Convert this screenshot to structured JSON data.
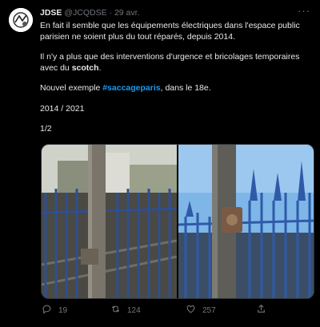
{
  "tweet": {
    "name": "JDSE",
    "handle": "@JCQDSE",
    "separator": "·",
    "date": "29 avr.",
    "more": "···",
    "p1": "En fait il semble que les équipements électriques dans l'espace public parisien ne soient plus du tout réparés, depuis 2014.",
    "p2_start": "Il n'y a plus que des interventions d'urgence et bricolages temporaires avec du ",
    "p2_bold": "scotch",
    "p2_end": ".",
    "p3_start": "Nouvel exemple ",
    "p3_hashtag": "#saccageparis",
    "p3_end": ", dans le 18e.",
    "p4": "2014 / 2021",
    "p5": "1/2"
  },
  "actions": {
    "reply_count": "19",
    "retweet_count": "124",
    "like_count": "257"
  },
  "icons": [
    "avatar",
    "more-icon",
    "reply-icon",
    "retweet-icon",
    "like-icon",
    "share-icon"
  ],
  "colors": {
    "background": "#000000",
    "text": "#e7e9ea",
    "muted": "#71767b",
    "link": "#1d9bf0"
  }
}
